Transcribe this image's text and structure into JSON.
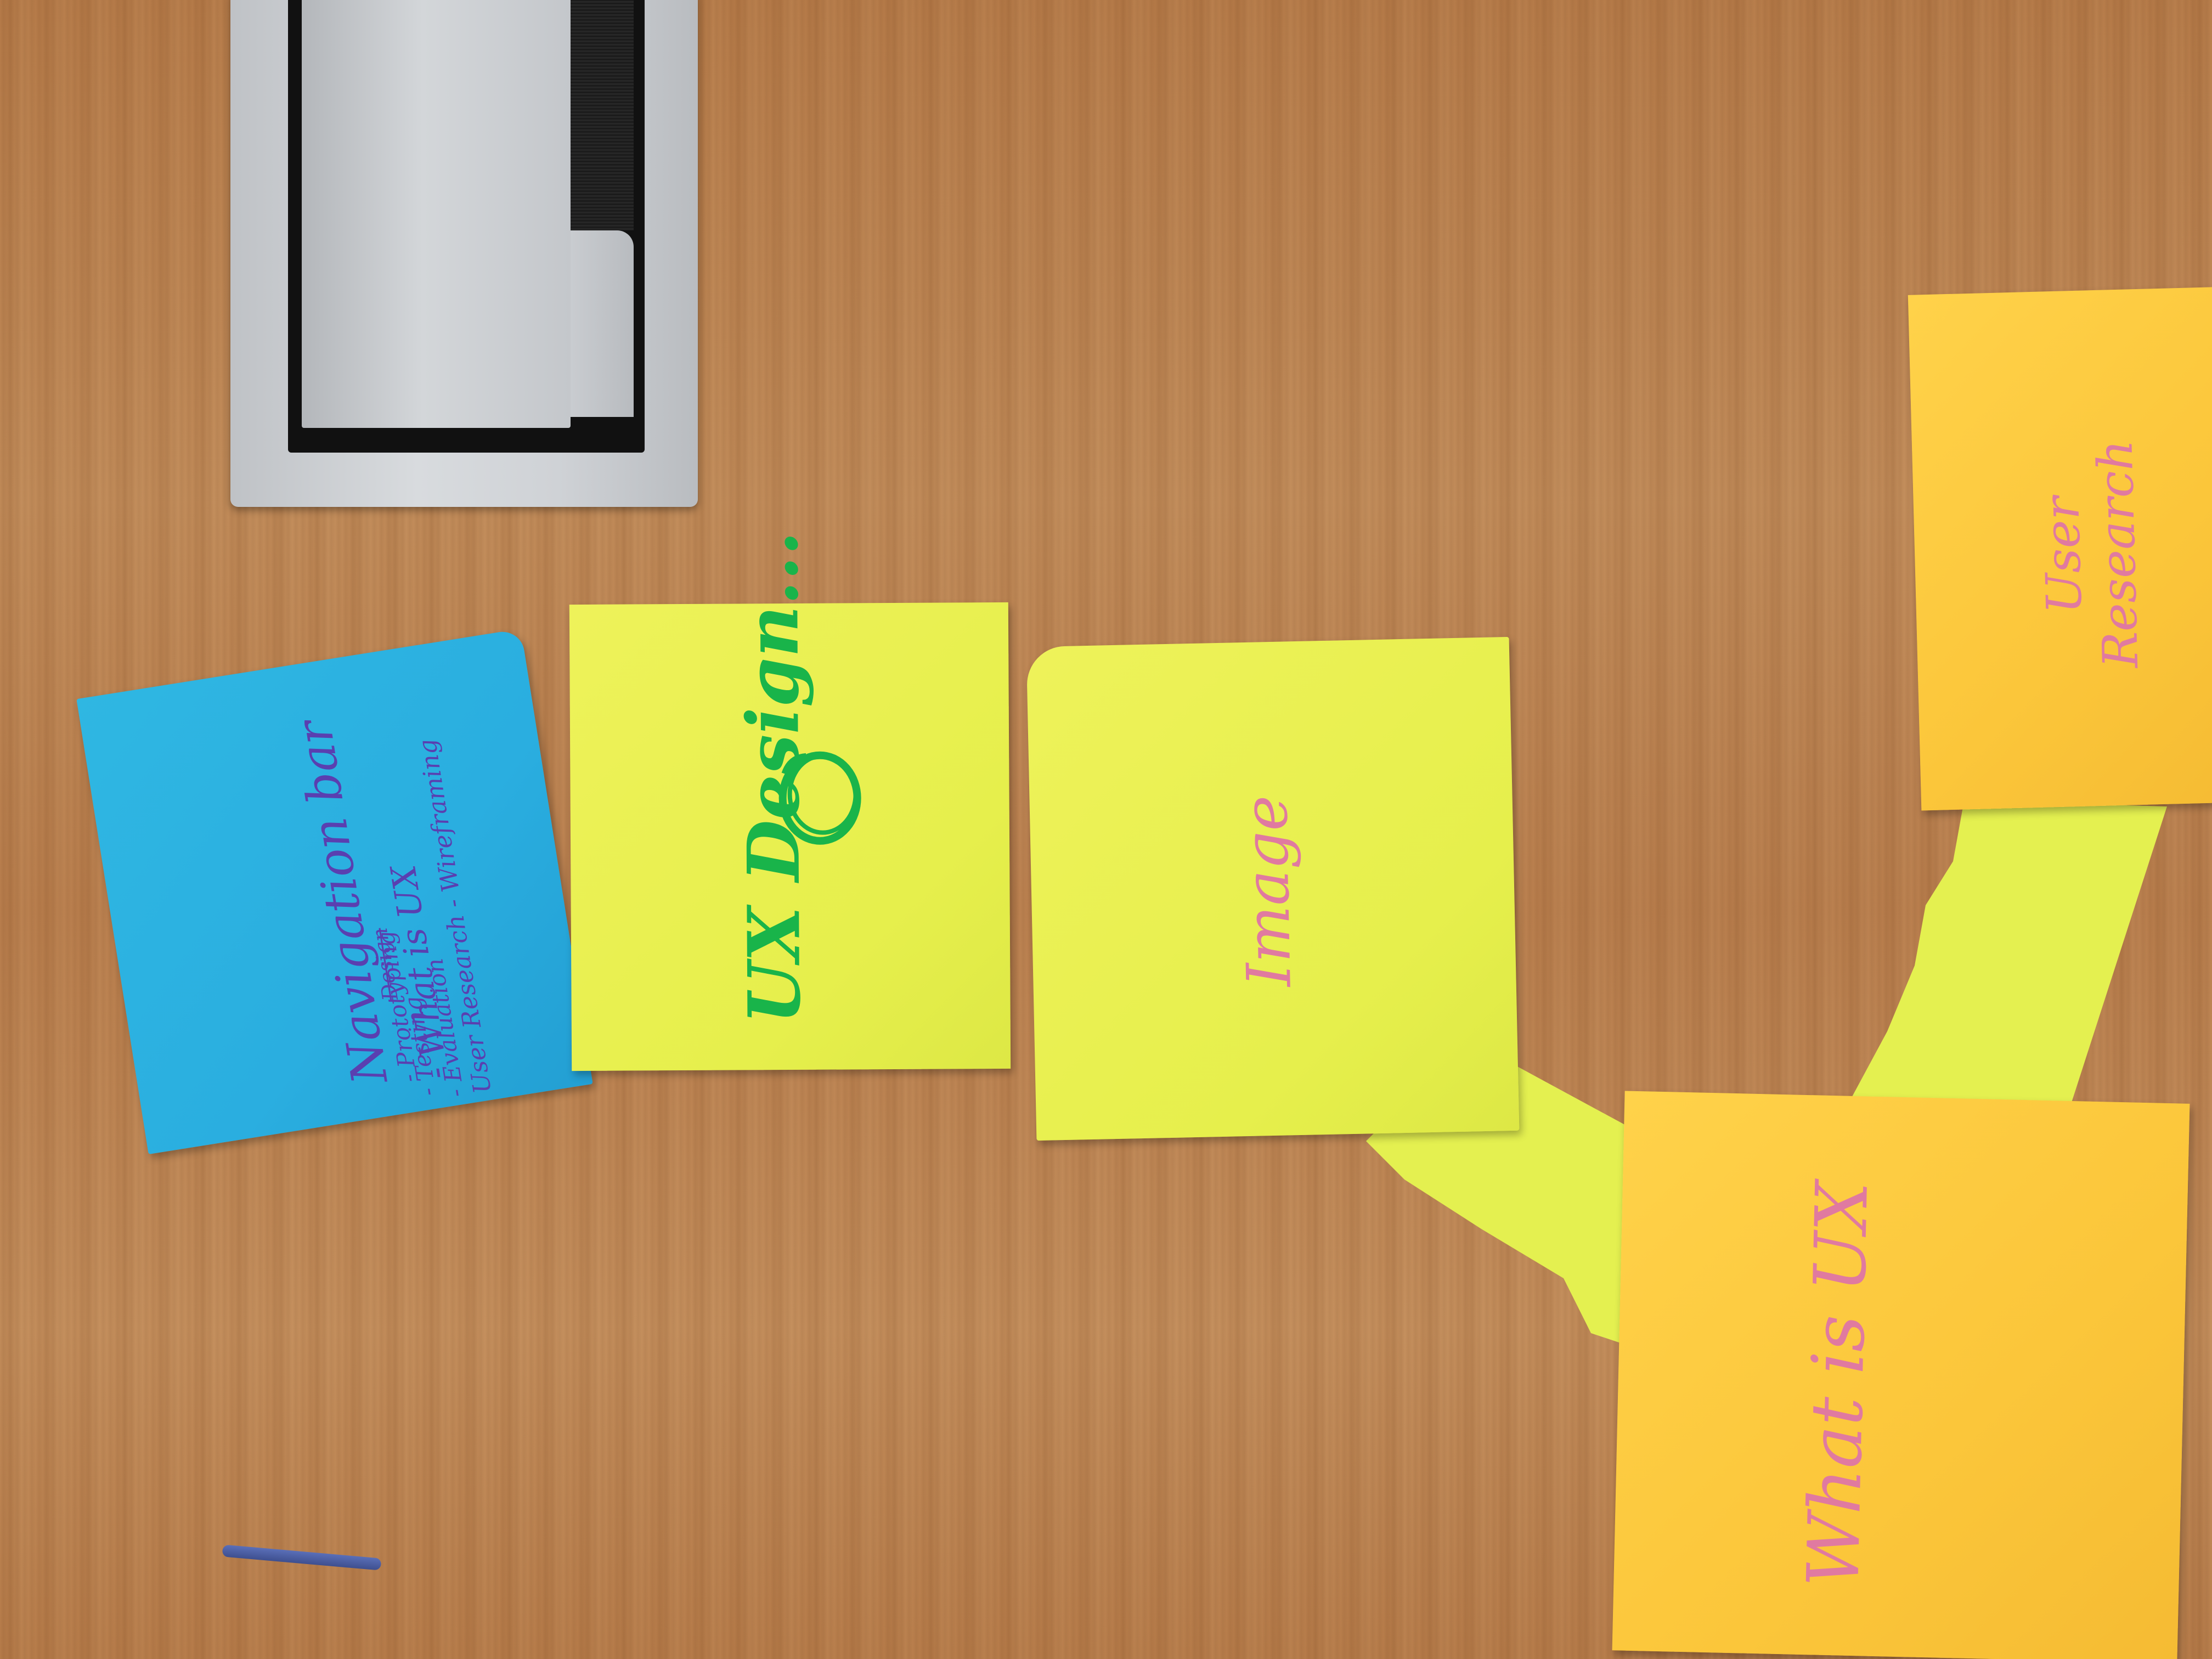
{
  "notes": {
    "navigation": {
      "title": "Navigation bar",
      "item1": "- What is UX",
      "item2": "User Research - Wireframing",
      "item3": "- Prototyping",
      "item4": "- Testing",
      "item5": "- Evaluation",
      "strike": "Design"
    },
    "ux_design": {
      "title": "UX Design..."
    },
    "image": {
      "title": "Image"
    },
    "what_is_ux": {
      "title": "What is UX"
    },
    "user_research": {
      "line1": "User",
      "line2": "Research"
    }
  },
  "colors": {
    "desk": "#b97f4f",
    "blue_note": "#2aaee0",
    "yellow_note": "#e6ef4c",
    "orange_note": "#fbc63a",
    "purple_ink": "#5a3fb0",
    "green_ink": "#19b44a",
    "pink_ink": "#e07aa0"
  }
}
